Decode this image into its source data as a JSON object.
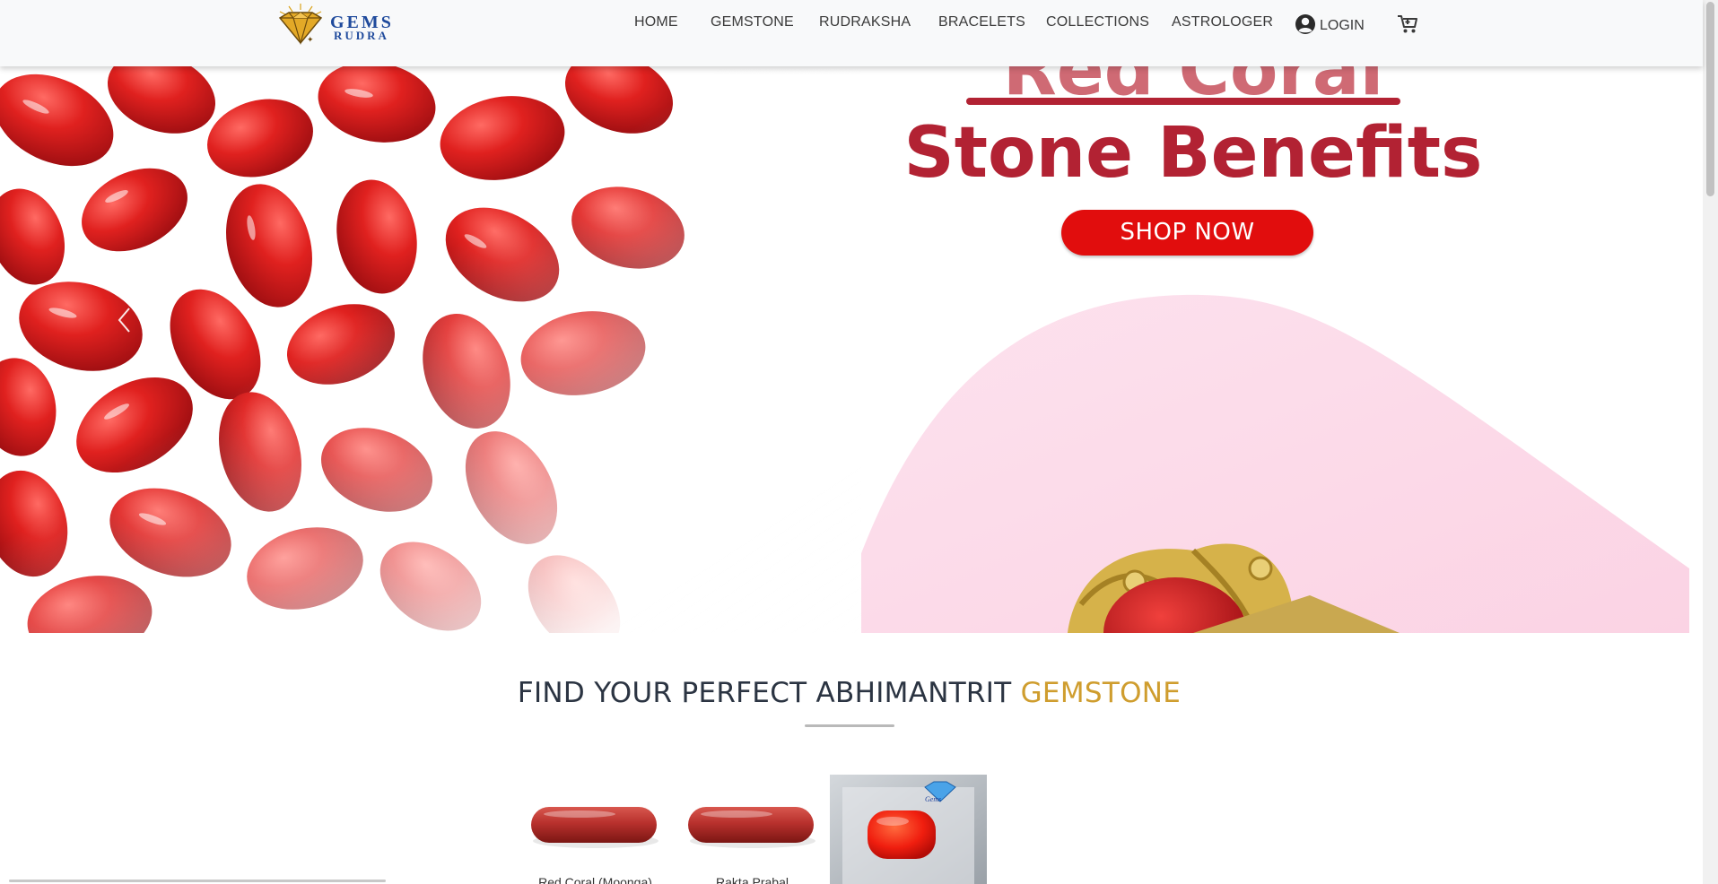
{
  "brand": {
    "line1": "GEMS",
    "line2": "RUDRA"
  },
  "nav": {
    "items": [
      {
        "label": "HOME"
      },
      {
        "label": "GEMSTONE"
      },
      {
        "label": "RUDRAKSHA"
      },
      {
        "label": "BRACELETS"
      },
      {
        "label": "COLLECTIONS"
      },
      {
        "label": "ASTROLOGER"
      }
    ],
    "login_label": "LOGIN",
    "cart_icon": "cart-icon",
    "user_icon": "user-circle-icon"
  },
  "hero": {
    "title_top": "Red Coral",
    "title": "Stone Benefits",
    "cta_label": "SHOP NOW",
    "prev_icon": "chevron-left-icon",
    "colors": {
      "accent": "#b22233",
      "button": "#e10d0d",
      "pink": "#fdd9e8"
    }
  },
  "section": {
    "title_main": "FIND YOUR PERFECT ABHIMANTRIT ",
    "title_accent": "GEMSTONE",
    "accent_color": "#cf9d2e"
  },
  "products": [
    {
      "name": "Red Coral (Moonga)"
    },
    {
      "name": "Rakta Prabal"
    },
    {
      "name": ""
    }
  ]
}
